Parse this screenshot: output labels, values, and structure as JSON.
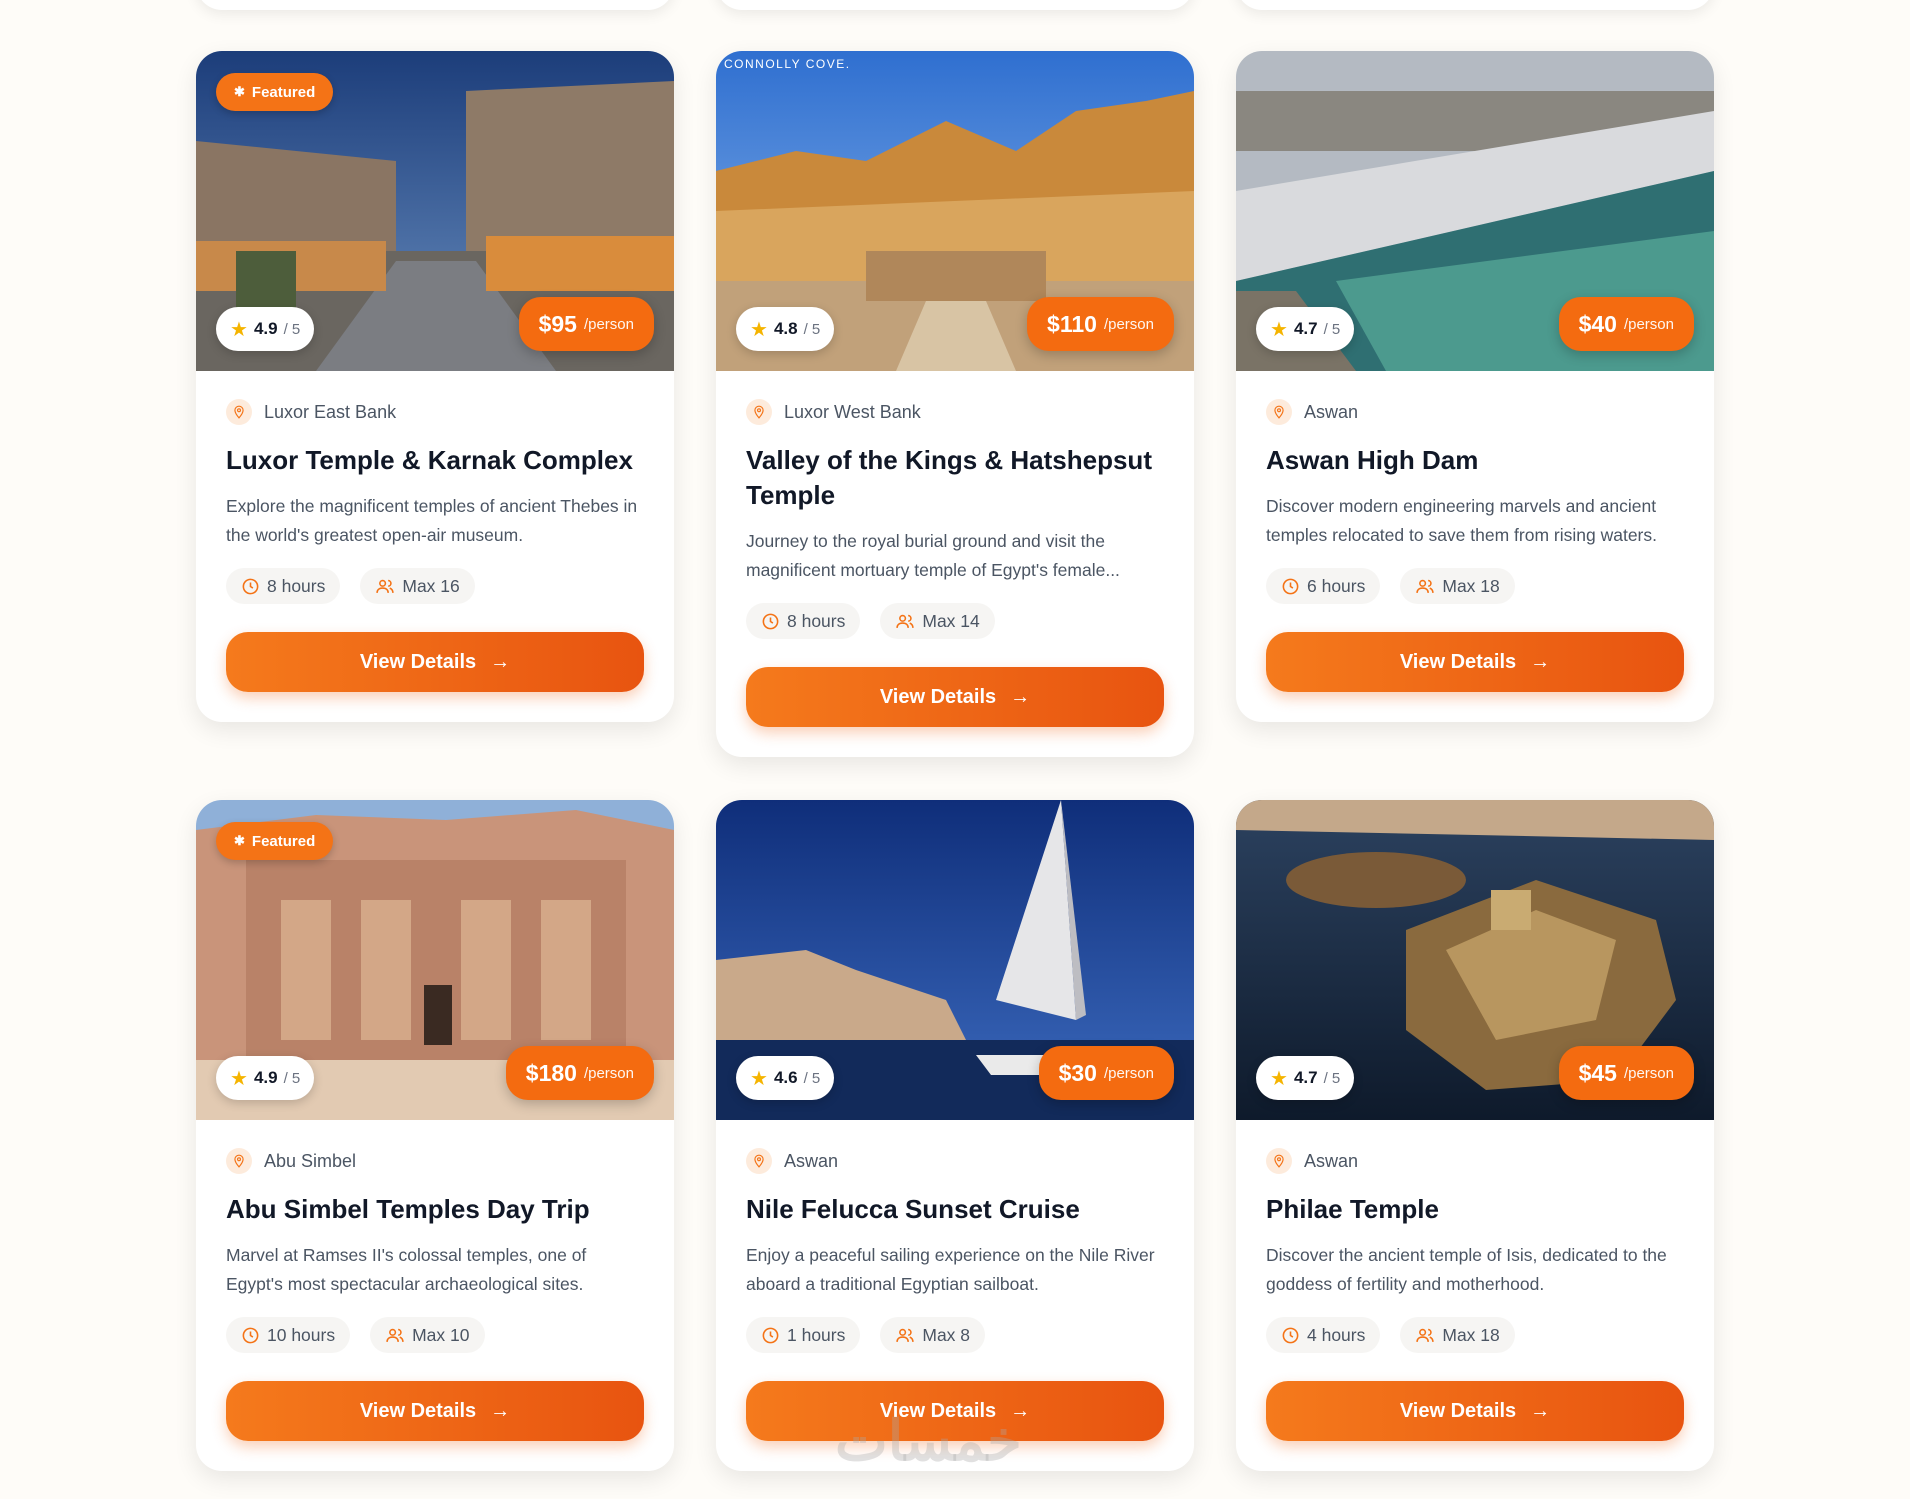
{
  "cards": [
    {
      "featured": "Featured",
      "rating": "4.9",
      "rating_max": "/ 5",
      "price": "$95",
      "per": "/person",
      "location": "Luxor East Bank",
      "title": "Luxor Temple & Karnak Complex",
      "description": "Explore the magnificent temples of ancient Thebes in the world's greatest open-air museum.",
      "duration": "8 hours",
      "group": "Max 16",
      "button": "View Details"
    },
    {
      "logo": "CONNOLLY COVE.",
      "rating": "4.8",
      "rating_max": "/ 5",
      "price": "$110",
      "per": "/person",
      "location": "Luxor West Bank",
      "title": "Valley of the Kings & Hatshepsut Temple",
      "description": "Journey to the royal burial ground and visit the magnificent mortuary temple of Egypt's female...",
      "duration": "8 hours",
      "group": "Max 14",
      "button": "View Details"
    },
    {
      "rating": "4.7",
      "rating_max": "/ 5",
      "price": "$40",
      "per": "/person",
      "location": "Aswan",
      "title": "Aswan High Dam",
      "description": "Discover modern engineering marvels and ancient temples relocated to save them from rising waters.",
      "duration": "6 hours",
      "group": "Max 18",
      "button": "View Details"
    },
    {
      "featured": "Featured",
      "rating": "4.9",
      "rating_max": "/ 5",
      "price": "$180",
      "per": "/person",
      "location": "Abu Simbel",
      "title": "Abu Simbel Temples Day Trip",
      "description": "Marvel at Ramses II's colossal temples, one of Egypt's most spectacular archaeological sites.",
      "duration": "10 hours",
      "group": "Max 10",
      "button": "View Details"
    },
    {
      "rating": "4.6",
      "rating_max": "/ 5",
      "price": "$30",
      "per": "/person",
      "location": "Aswan",
      "title": "Nile Felucca Sunset Cruise",
      "description": "Enjoy a peaceful sailing experience on the Nile River aboard a traditional Egyptian sailboat.",
      "duration": "1 hours",
      "group": "Max 8",
      "button": "View Details"
    },
    {
      "rating": "4.7",
      "rating_max": "/ 5",
      "price": "$45",
      "per": "/person",
      "location": "Aswan",
      "title": "Philae Temple",
      "description": "Discover the ancient temple of Isis, dedicated to the goddess of fertility and motherhood.",
      "duration": "4 hours",
      "group": "Max 18",
      "button": "View Details"
    }
  ],
  "watermark": "خمسات",
  "colors": {
    "accent": "#f47316",
    "star": "#f5b400"
  }
}
